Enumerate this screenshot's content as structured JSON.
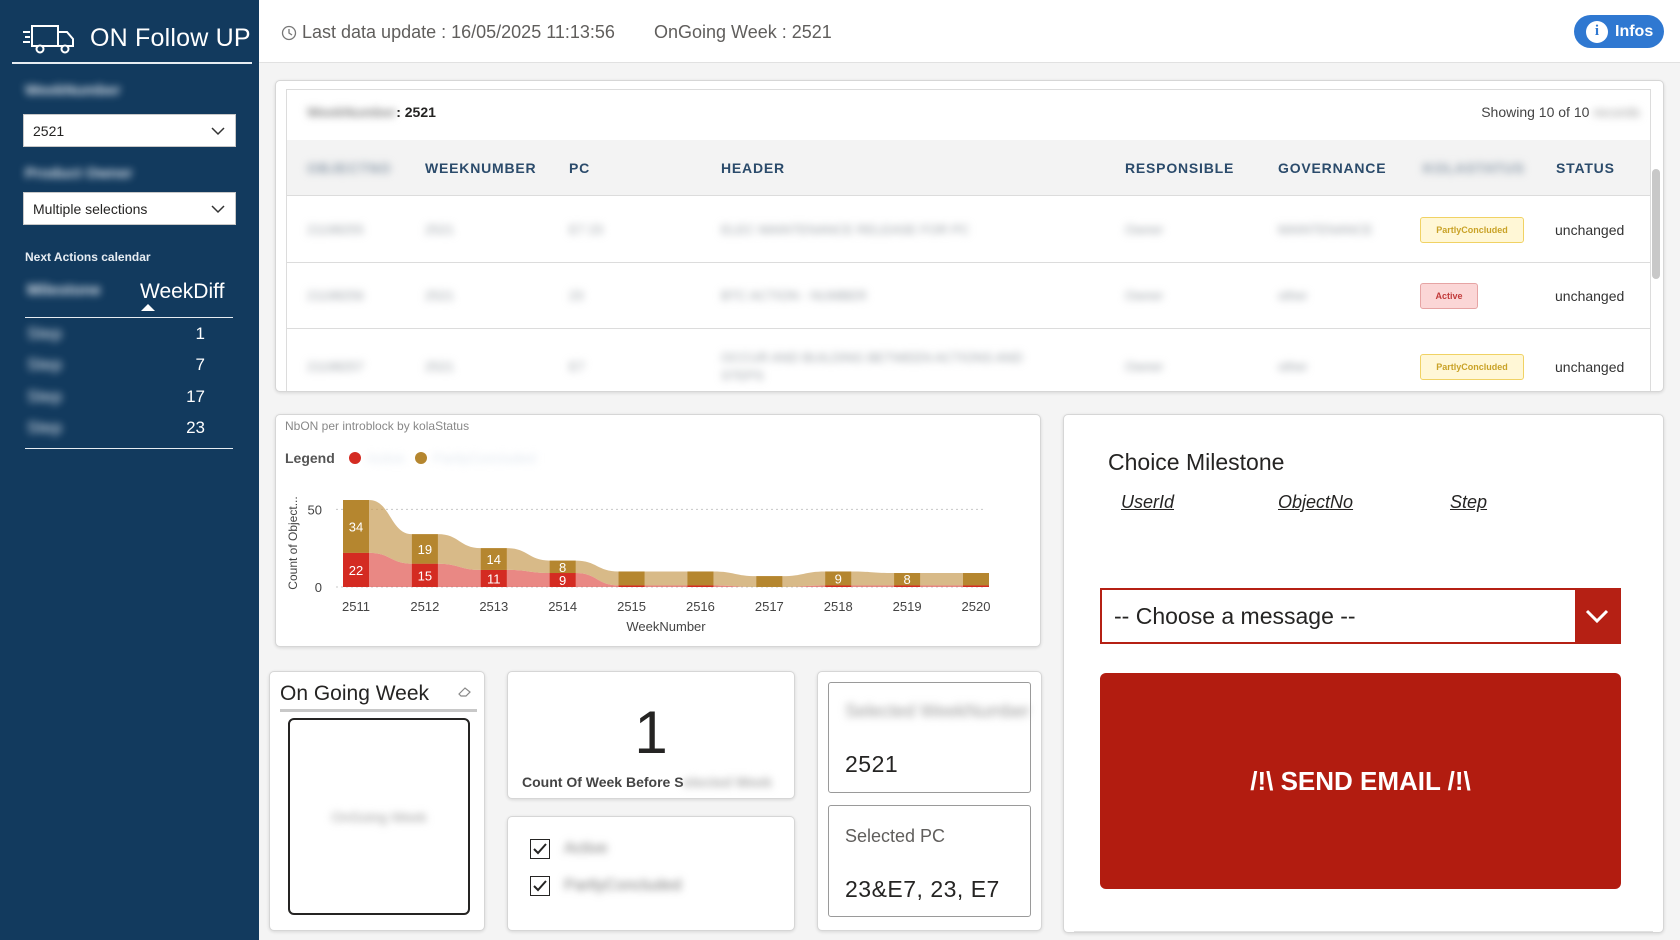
{
  "sidebar": {
    "title": "ON Follow UP",
    "slicer1": {
      "label": "WeekNumber",
      "value": "2521"
    },
    "slicer2": {
      "label": "Product Owner",
      "value": "Multiple selections"
    },
    "next_actions": {
      "label": "Next Actions calendar",
      "col1": "Milestone",
      "col2": "WeekDiff",
      "rows": [
        {
          "name": "Step",
          "diff": "1"
        },
        {
          "name": "Step",
          "diff": "7"
        },
        {
          "name": "Step",
          "diff": "17"
        },
        {
          "name": "Step",
          "diff": "23"
        }
      ]
    }
  },
  "topbar": {
    "last_update": "Last data update : 16/05/2025 11:13:56",
    "ongoing_week": "OnGoing Week : 2521",
    "infos": "Infos"
  },
  "table": {
    "title_prefix": "WeekNumber",
    "title_value": ": 2521",
    "showing": "Showing 10 of 10",
    "showing_suffix": "records",
    "columns": [
      "OBJECTNO",
      "WEEKNUMBER",
      "PC",
      "HEADER",
      "RESPONSIBLE",
      "GOVERNANCE",
      "KOLASTATUS",
      "STATUS"
    ],
    "rows": [
      {
        "objectno": "21198255",
        "week": "2521",
        "pc": "E7 23",
        "header": "ELEC MAINTENANCE RELEASE FOR PC",
        "responsible": "Owner",
        "governance": "MAINTENANCE",
        "kola": "PartlyConcluded",
        "kola_type": "partly",
        "status": "unchanged"
      },
      {
        "objectno": "21198256",
        "week": "2521",
        "pc": "23",
        "header": "BTC ACTION - NUMBER",
        "responsible": "Owner",
        "governance": "other",
        "kola": "Active",
        "kola_type": "active",
        "status": "unchanged"
      },
      {
        "objectno": "21198257",
        "week": "2521",
        "pc": "E7",
        "header": "OCCUR AND BUILDING BETWEEN ACTIONS AND STEPS",
        "responsible": "Owner",
        "governance": "other",
        "kola": "PartlyConcluded",
        "kola_type": "partly",
        "status": "unchanged"
      }
    ]
  },
  "chart": {
    "title": "NbON per introblock by kolaStatus",
    "legend_title": "Legend",
    "legend": [
      {
        "name": "Active",
        "color": "#d42b22"
      },
      {
        "name": "PartlyConcluded",
        "color": "#b5862f"
      }
    ]
  },
  "chart_data": {
    "type": "area",
    "title": "NbON per introblock by kolaStatus",
    "xlabel": "WeekNumber",
    "ylabel": "Count of Object...",
    "categories": [
      "2511",
      "2512",
      "2513",
      "2514",
      "2515",
      "2516",
      "2517",
      "2518",
      "2519",
      "2520"
    ],
    "yticks": [
      0,
      50
    ],
    "ylim": [
      0,
      56
    ],
    "series": [
      {
        "name": "Active",
        "color": "#d42b22",
        "values": [
          22,
          15,
          11,
          9,
          1,
          1,
          0,
          1,
          1,
          1
        ]
      },
      {
        "name": "PartlyConcluded",
        "color": "#b5862f",
        "values": [
          34,
          19,
          14,
          8,
          9,
          9,
          7,
          9,
          8,
          8
        ]
      }
    ],
    "labels": [
      {
        "series": 0,
        "index": 0,
        "text": "22"
      },
      {
        "series": 1,
        "index": 0,
        "text": "34"
      },
      {
        "series": 0,
        "index": 1,
        "text": "15"
      },
      {
        "series": 1,
        "index": 1,
        "text": "19"
      },
      {
        "series": 0,
        "index": 2,
        "text": "11"
      },
      {
        "series": 1,
        "index": 2,
        "text": "14"
      },
      {
        "series": 0,
        "index": 3,
        "text": "9"
      },
      {
        "series": 1,
        "index": 3,
        "text": "8"
      },
      {
        "series": 1,
        "index": 7,
        "text": "9"
      },
      {
        "series": 1,
        "index": 8,
        "text": "8"
      }
    ]
  },
  "milestone": {
    "title": "Choice Milestone",
    "col1": "UserId",
    "col2": "ObjectNo",
    "col3": "Step",
    "select_placeholder": "-- Choose a message --",
    "send": "/!\\ SEND EMAIL /!\\"
  },
  "ongoing_card": {
    "title": "On Going Week",
    "placeholder": "OnGoing Week"
  },
  "count_card": {
    "value": "1",
    "label": "Count Of Week Before S",
    "label_hidden": "elected Week"
  },
  "checks": [
    {
      "label": "Active",
      "checked": true
    },
    {
      "label": "PartlyConcluded",
      "checked": true
    }
  ],
  "selected": {
    "box1_label": "Selected WeekNumber",
    "box1_value": "2521",
    "box2_label": "Selected PC",
    "box2_value": "23&E7, 23, E7"
  }
}
